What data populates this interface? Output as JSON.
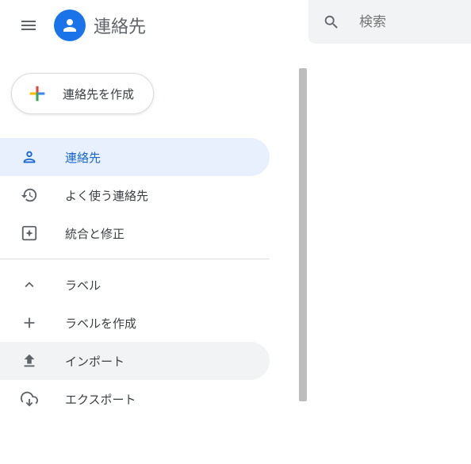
{
  "app": {
    "title": "連絡先"
  },
  "search": {
    "placeholder": "検索"
  },
  "create_button": {
    "label": "連絡先を作成"
  },
  "nav": {
    "contacts": "連絡先",
    "frequent": "よく使う連絡先",
    "merge_fix": "統合と修正",
    "labels": "ラベル",
    "create_label": "ラベルを作成",
    "import": "インポート",
    "export": "エクスポート"
  }
}
